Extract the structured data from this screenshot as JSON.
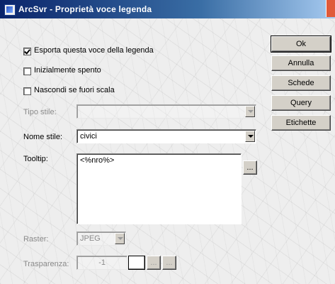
{
  "window": {
    "title": "ArcSvr - Proprietà voce legenda"
  },
  "options": {
    "esporta": {
      "label": "Esporta questa voce della legenda",
      "checked": true
    },
    "inizialmente_spento": {
      "label": "Inizialmente spento",
      "checked": false
    },
    "nascondi": {
      "label": "Nascondi se fuori scala",
      "checked": false
    }
  },
  "tipo_stile": {
    "label": "Tipo stile:",
    "value": ""
  },
  "nome_stile": {
    "label": "Nome stile:",
    "value": "civici"
  },
  "tooltip": {
    "label": "Tooltip:",
    "value": "<%nro%>",
    "button": "..."
  },
  "raster": {
    "label": "Raster:",
    "value": "JPEG"
  },
  "trasparenza": {
    "label": "Trasparenza:",
    "value": "-1",
    "button1": "...",
    "button2": "..."
  },
  "buttons": {
    "ok": "Ok",
    "annulla": "Annulla",
    "schede": "Schede",
    "query": "Query",
    "etichette": "Etichette"
  }
}
